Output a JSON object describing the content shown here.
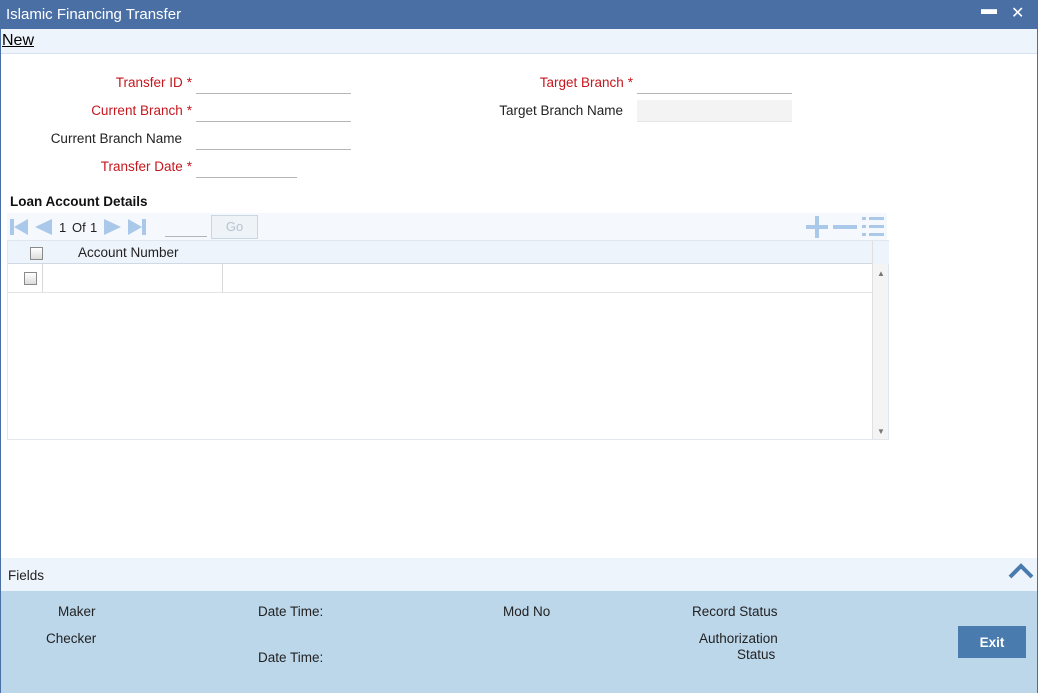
{
  "window": {
    "title": "Islamic Financing Transfer",
    "minimize_glyph": "▬",
    "close_glyph": "✕"
  },
  "menu": {
    "new_label": "New"
  },
  "form": {
    "transfer_id": {
      "label": "Transfer ID",
      "required": "*",
      "value": ""
    },
    "current_branch": {
      "label": "Current Branch",
      "required": "*",
      "value": ""
    },
    "current_branch_name": {
      "label": "Current Branch Name",
      "value": ""
    },
    "transfer_date": {
      "label": "Transfer Date",
      "required": "*",
      "value": ""
    },
    "target_branch": {
      "label": "Target Branch",
      "required": "*",
      "value": ""
    },
    "target_branch_name": {
      "label": "Target Branch Name",
      "value": ""
    }
  },
  "loan_details": {
    "title": "Loan Account Details",
    "pager": {
      "current": "1",
      "of_label": "Of",
      "total": "1",
      "page_input": "",
      "go_label": "Go"
    },
    "columns": [
      "Account Number"
    ],
    "rows": [
      {
        "account_number": ""
      }
    ],
    "icons": [
      "first-page-icon",
      "previous-page-icon",
      "next-page-icon",
      "last-page-icon",
      "add-row-icon",
      "delete-row-icon",
      "single-view-icon"
    ]
  },
  "footer": {
    "fields_label": "Fields",
    "maker_label": "Maker",
    "checker_label": "Checker",
    "date_time_label_1": "Date Time:",
    "date_time_label_2": "Date Time:",
    "mod_no_label": "Mod No",
    "record_status_label": "Record Status",
    "authorization_label_line1": "Authorization",
    "authorization_label_line2": "Status",
    "exit_label": "Exit"
  },
  "colors": {
    "titlebar": "#4a6fa5",
    "required": "#c4171e",
    "audit_panel": "#bcd6ea",
    "exit_button": "#4a7bae",
    "nav_icon": "#a9c8ea"
  }
}
